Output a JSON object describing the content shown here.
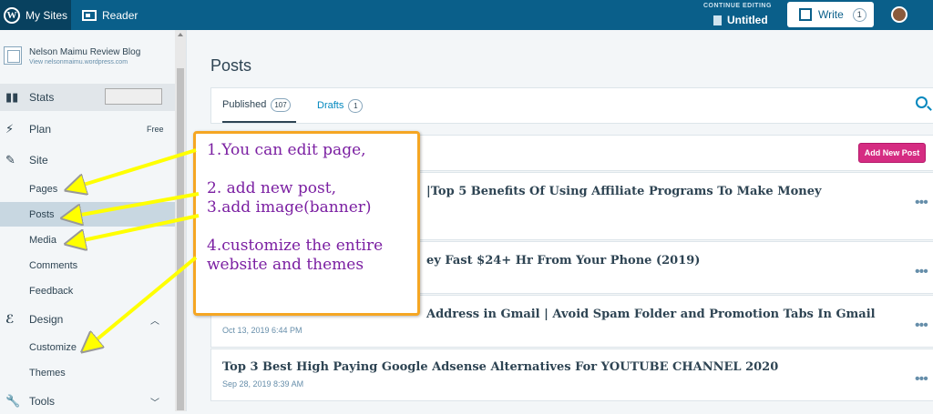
{
  "topbar": {
    "my_sites": "My Sites",
    "reader": "Reader",
    "continue_editing": "CONTINUE EDITING",
    "untitled": "Untitled",
    "write": "Write",
    "write_count": "1"
  },
  "sidebar": {
    "site_name": "Nelson Maimu Review Blog",
    "site_url": "View nelsonmaimu.wordpress.com",
    "stats": "Stats",
    "plan": "Plan",
    "plan_badge": "Free",
    "site": "Site",
    "site_items": [
      "Pages",
      "Posts",
      "Media",
      "Comments",
      "Feedback"
    ],
    "design": "Design",
    "design_items": [
      "Customize",
      "Themes"
    ],
    "tools": "Tools",
    "active_item": "Posts"
  },
  "main": {
    "title": "Posts",
    "tabs": [
      {
        "label": "Published",
        "count": "107"
      },
      {
        "label": "Drafts",
        "count": "1"
      }
    ],
    "add_new_post": "Add New Post",
    "posts": [
      {
        "title": "|Top 5 Benefits Of Using Affiliate Programs To Make Money",
        "date": ""
      },
      {
        "title": "ey Fast $24+ Hr From Your Phone (2019)",
        "date": ""
      },
      {
        "title": "Address in Gmail | Avoid Spam Folder and Promotion Tabs In Gmail",
        "date": "Oct 13, 2019 6:44 PM"
      },
      {
        "title": "Top 3 Best High Paying Google Adsense Alternatives For YOUTUBE CHANNEL 2020",
        "date": "Sep 28, 2019 8:39 AM"
      }
    ]
  },
  "annotation": {
    "lines": [
      "1.You can edit page,",
      "",
      "2. add new post,",
      "3.add image(banner)",
      "",
      "4.customize the entire",
      "website and themes"
    ],
    "border_color": "#f5a623",
    "text_color": "#7b1fa2",
    "arrow_color": "#ffff00"
  },
  "colors": {
    "topbar": "#0a5f8a",
    "accent": "#0087be",
    "add_button": "#d52c82"
  }
}
